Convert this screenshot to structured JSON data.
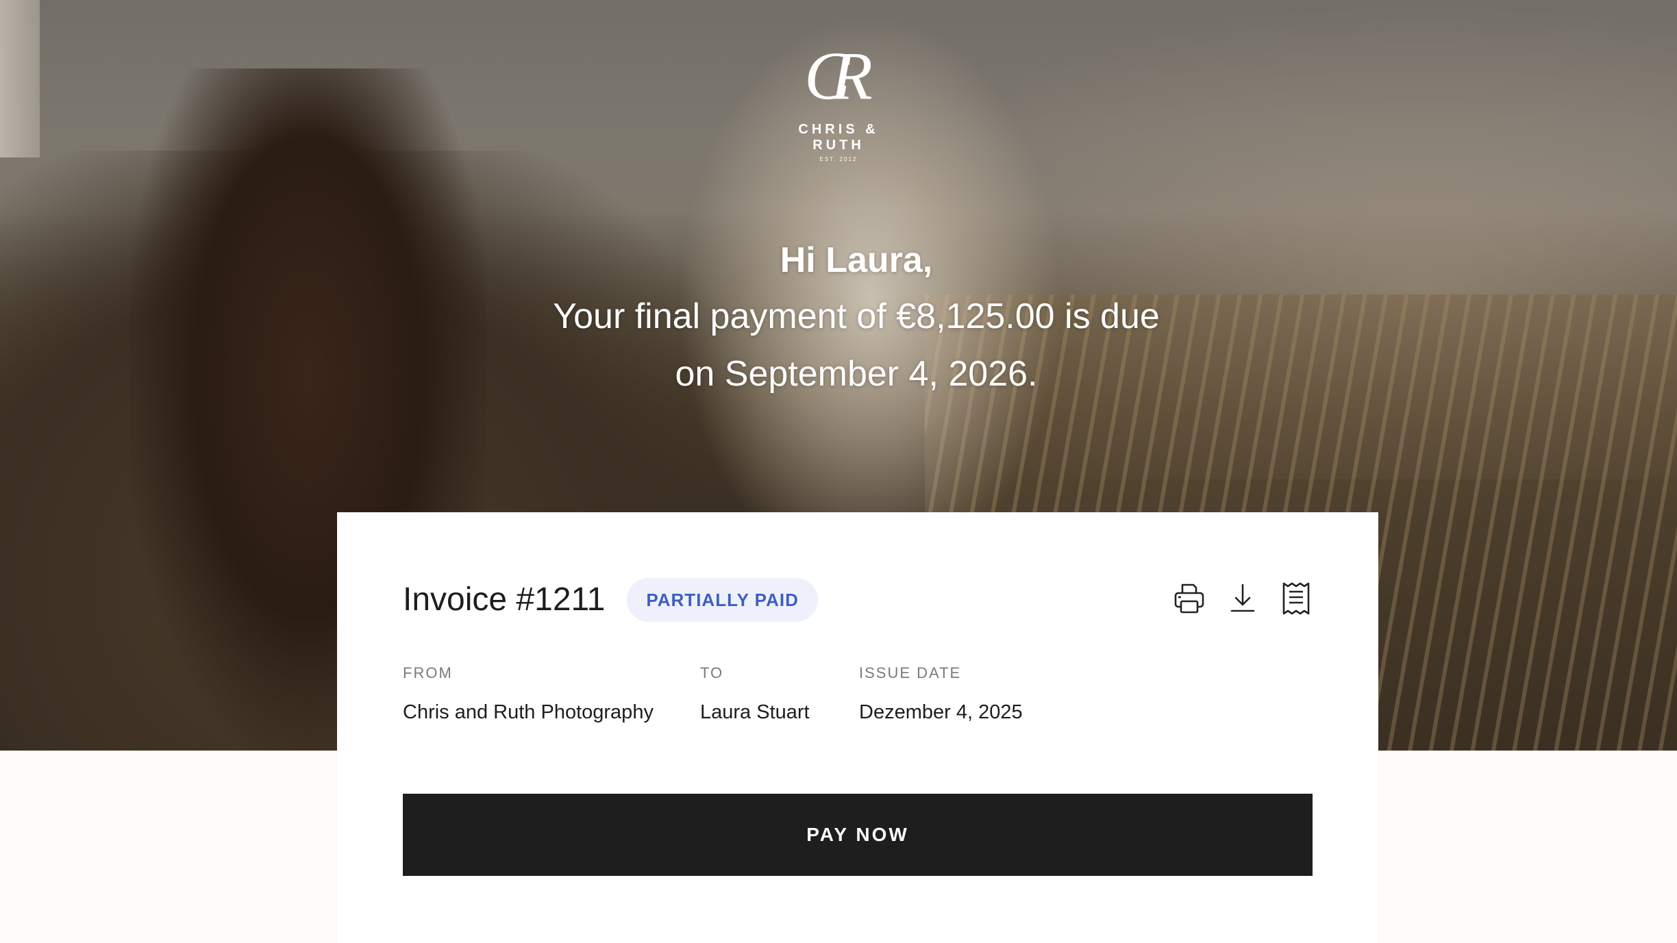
{
  "brand": {
    "logo_monogram": "CR",
    "logo_name": "CHRIS & RUTH",
    "logo_est": "EST. 2012"
  },
  "greeting": {
    "hi": "Hi Laura,",
    "line1": "Your final payment of €8,125.00 is due",
    "line2": "on September 4, 2026."
  },
  "invoice": {
    "title": "Invoice #1211",
    "status": "PARTIALLY PAID",
    "status_color": "#3f5fbf",
    "actions": [
      {
        "icon": "printer-icon",
        "label": "Print"
      },
      {
        "icon": "download-icon",
        "label": "Download"
      },
      {
        "icon": "receipt-icon",
        "label": "Receipt"
      }
    ],
    "from_label": "FROM",
    "from_value": "Chris and Ruth Photography",
    "to_label": "TO",
    "to_value": "Laura Stuart",
    "date_label": "ISSUE DATE",
    "date_value": "Dezember 4, 2025",
    "pay_label": "PAY NOW"
  },
  "colors": {
    "button_bg": "#1e1e1e",
    "badge_bg": "#eef1fb",
    "page_bg": "#fdfcfa"
  }
}
